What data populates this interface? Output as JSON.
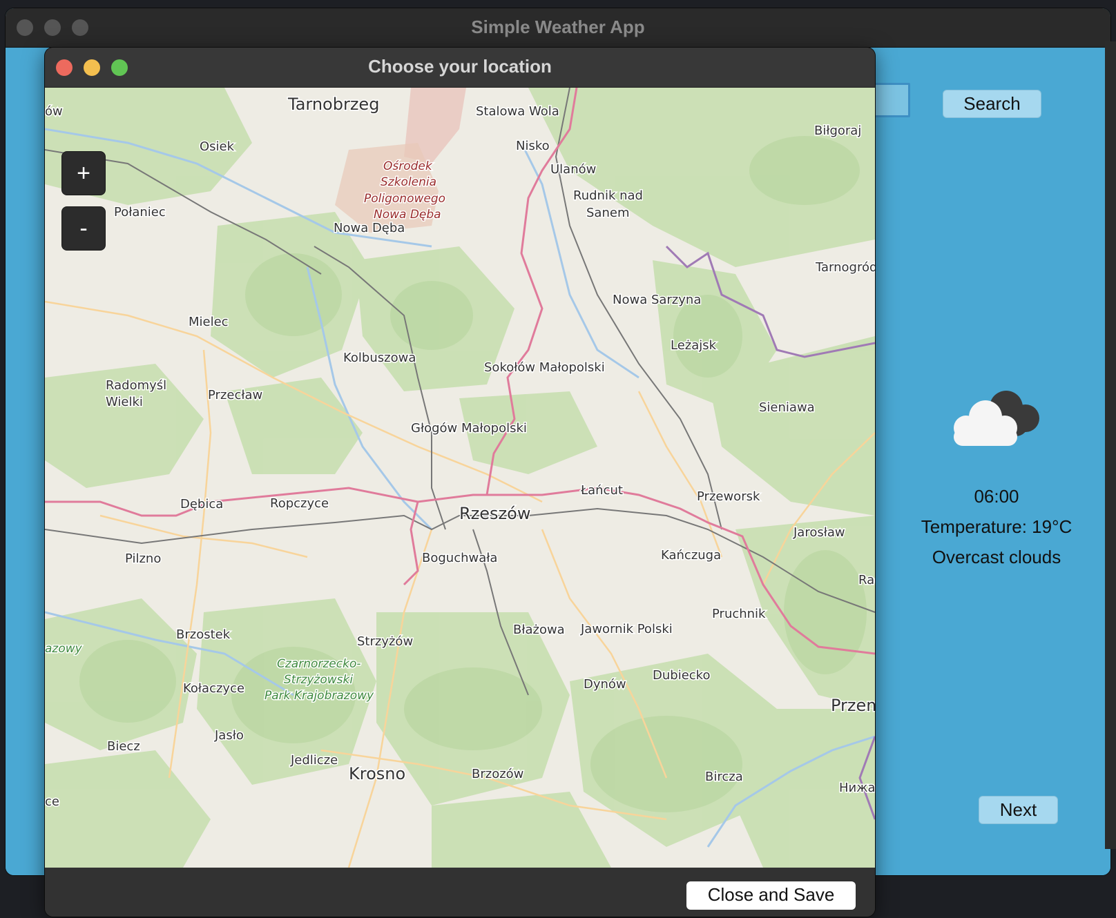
{
  "main_window": {
    "title": "Simple Weather App",
    "search_label": "Search",
    "next_label": "Next",
    "weather": {
      "time": "06:00",
      "temperature": "Temperature: 19°C",
      "description": "Overcast clouds",
      "icon": "overcast-clouds-icon"
    },
    "background_color": "#4aa8d3"
  },
  "dialog": {
    "title": "Choose your location",
    "zoom_in_label": "+",
    "zoom_out_label": "-",
    "close_save_label": "Close and Save"
  },
  "map": {
    "places": [
      {
        "name": "Tarnobrzeg",
        "big": true
      },
      {
        "name": "Stalowa Wola"
      },
      {
        "name": "Biłgoraj"
      },
      {
        "name": "Osiek"
      },
      {
        "name": "Nisko"
      },
      {
        "name": "Ulanów"
      },
      {
        "name": "Rudnik nad"
      },
      {
        "name": "Sanem"
      },
      {
        "name": "Połaniec"
      },
      {
        "name": "Nowa Dęba"
      },
      {
        "name": "Tarnogród"
      },
      {
        "name": "Nowa Sarzyna"
      },
      {
        "name": "Mielec"
      },
      {
        "name": "Leżajsk"
      },
      {
        "name": "Kolbuszowa"
      },
      {
        "name": "Sokołów Małopolski"
      },
      {
        "name": "Radomyśl"
      },
      {
        "name": "Wielki"
      },
      {
        "name": "Przecław"
      },
      {
        "name": "Sieniawa"
      },
      {
        "name": "Głogów Małopolski"
      },
      {
        "name": "Łańcut"
      },
      {
        "name": "Dębica"
      },
      {
        "name": "Ropczyce"
      },
      {
        "name": "Przeworsk"
      },
      {
        "name": "Rzeszów",
        "big": true
      },
      {
        "name": "Jarosław"
      },
      {
        "name": "Pilzno"
      },
      {
        "name": "Boguchwała"
      },
      {
        "name": "Kańczuga"
      },
      {
        "name": "Rady"
      },
      {
        "name": "Pruchnik"
      },
      {
        "name": "Brzostek"
      },
      {
        "name": "Strzyżów"
      },
      {
        "name": "Błażowa"
      },
      {
        "name": "Jawornik Polski"
      },
      {
        "name": "Dubiecko"
      },
      {
        "name": "Kołaczyce"
      },
      {
        "name": "Dynów"
      },
      {
        "name": "Przemyś",
        "big": true
      },
      {
        "name": "Biecz"
      },
      {
        "name": "Jasło"
      },
      {
        "name": "Jedlicze"
      },
      {
        "name": "Krosno",
        "big": true
      },
      {
        "name": "Brzozów"
      },
      {
        "name": "Bircza"
      },
      {
        "name": "Нижанк"
      },
      {
        "name": "ów"
      },
      {
        "name": "ce"
      }
    ],
    "areas": [
      {
        "name": "Ośrodek"
      },
      {
        "name": "Szkolenia"
      },
      {
        "name": "Poligonowego"
      },
      {
        "name": "Nowa Dęba"
      },
      {
        "name": "Czarnorzecko-"
      },
      {
        "name": "Strzyżowski"
      },
      {
        "name": "Park Krajobrazowy"
      },
      {
        "name": "azowy"
      }
    ]
  }
}
